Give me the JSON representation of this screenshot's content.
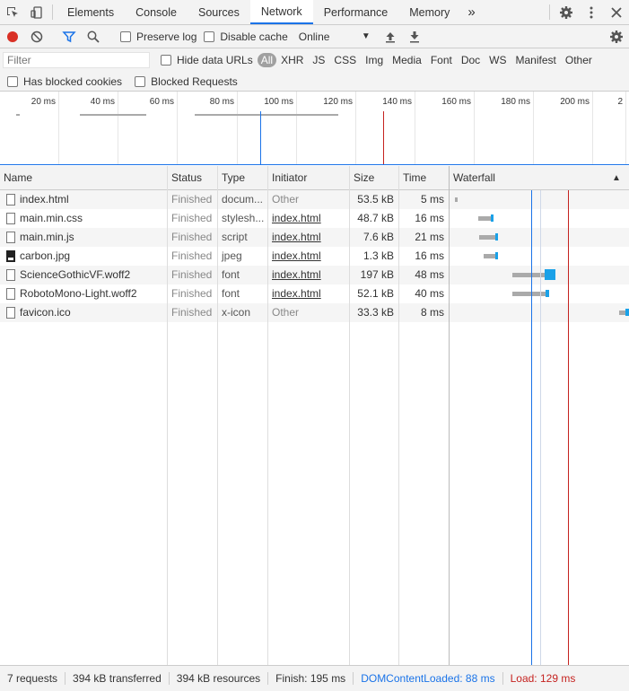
{
  "tabs": [
    {
      "label": "Elements",
      "active": false
    },
    {
      "label": "Console",
      "active": false
    },
    {
      "label": "Sources",
      "active": false
    },
    {
      "label": "Network",
      "active": true
    },
    {
      "label": "Performance",
      "active": false
    },
    {
      "label": "Memory",
      "active": false
    }
  ],
  "tabs_more": "»",
  "toolbar": {
    "preserve_log": "Preserve log",
    "disable_cache": "Disable cache",
    "throttling": "Online"
  },
  "filter": {
    "placeholder": "Filter",
    "hide_data_urls": "Hide data URLs",
    "types": [
      "All",
      "XHR",
      "JS",
      "CSS",
      "Img",
      "Media",
      "Font",
      "Doc",
      "WS",
      "Manifest",
      "Other"
    ],
    "has_blocked_cookies": "Has blocked cookies",
    "blocked_requests": "Blocked Requests"
  },
  "overview": {
    "tick_labels": [
      "20 ms",
      "40 ms",
      "60 ms",
      "80 ms",
      "100 ms",
      "120 ms",
      "140 ms",
      "160 ms",
      "180 ms",
      "200 ms",
      "2"
    ]
  },
  "columns": {
    "name": "Name",
    "status": "Status",
    "type": "Type",
    "initiator": "Initiator",
    "size": "Size",
    "time": "Time",
    "waterfall": "Waterfall",
    "sort_indicator": "▲"
  },
  "requests": [
    {
      "name": "index.html",
      "status": "Finished",
      "type": "docum...",
      "initiator": "Other",
      "initiator_link": false,
      "size": "53.5 kB",
      "time": "5 ms",
      "icon": "document"
    },
    {
      "name": "main.min.css",
      "status": "Finished",
      "type": "stylesh...",
      "initiator": "index.html",
      "initiator_link": true,
      "size": "48.7 kB",
      "time": "16 ms",
      "icon": "document"
    },
    {
      "name": "main.min.js",
      "status": "Finished",
      "type": "script",
      "initiator": "index.html",
      "initiator_link": true,
      "size": "7.6 kB",
      "time": "21 ms",
      "icon": "document"
    },
    {
      "name": "carbon.jpg",
      "status": "Finished",
      "type": "jpeg",
      "initiator": "index.html",
      "initiator_link": true,
      "size": "1.3 kB",
      "time": "16 ms",
      "icon": "image"
    },
    {
      "name": "ScienceGothicVF.woff2",
      "status": "Finished",
      "type": "font",
      "initiator": "index.html",
      "initiator_link": true,
      "size": "197 kB",
      "time": "48 ms",
      "icon": "document"
    },
    {
      "name": "RobotoMono-Light.woff2",
      "status": "Finished",
      "type": "font",
      "initiator": "index.html",
      "initiator_link": true,
      "size": "52.1 kB",
      "time": "40 ms",
      "icon": "document"
    },
    {
      "name": "favicon.ico",
      "status": "Finished",
      "type": "x-icon",
      "initiator": "Other",
      "initiator_link": false,
      "size": "33.3 kB",
      "time": "8 ms",
      "icon": "document"
    }
  ],
  "status_bar": {
    "requests": "7 requests",
    "transferred": "394 kB transferred",
    "resources": "394 kB resources",
    "finish": "Finish: 195 ms",
    "dom_content_loaded": "DOMContentLoaded: 88 ms",
    "load": "Load: 129 ms"
  },
  "colors": {
    "accent": "#1a73e8",
    "record": "#d93025",
    "load_line": "#c5221f",
    "waterfall_receive": "#1aa1e8",
    "waterfall_wait": "#aaaaaa"
  }
}
